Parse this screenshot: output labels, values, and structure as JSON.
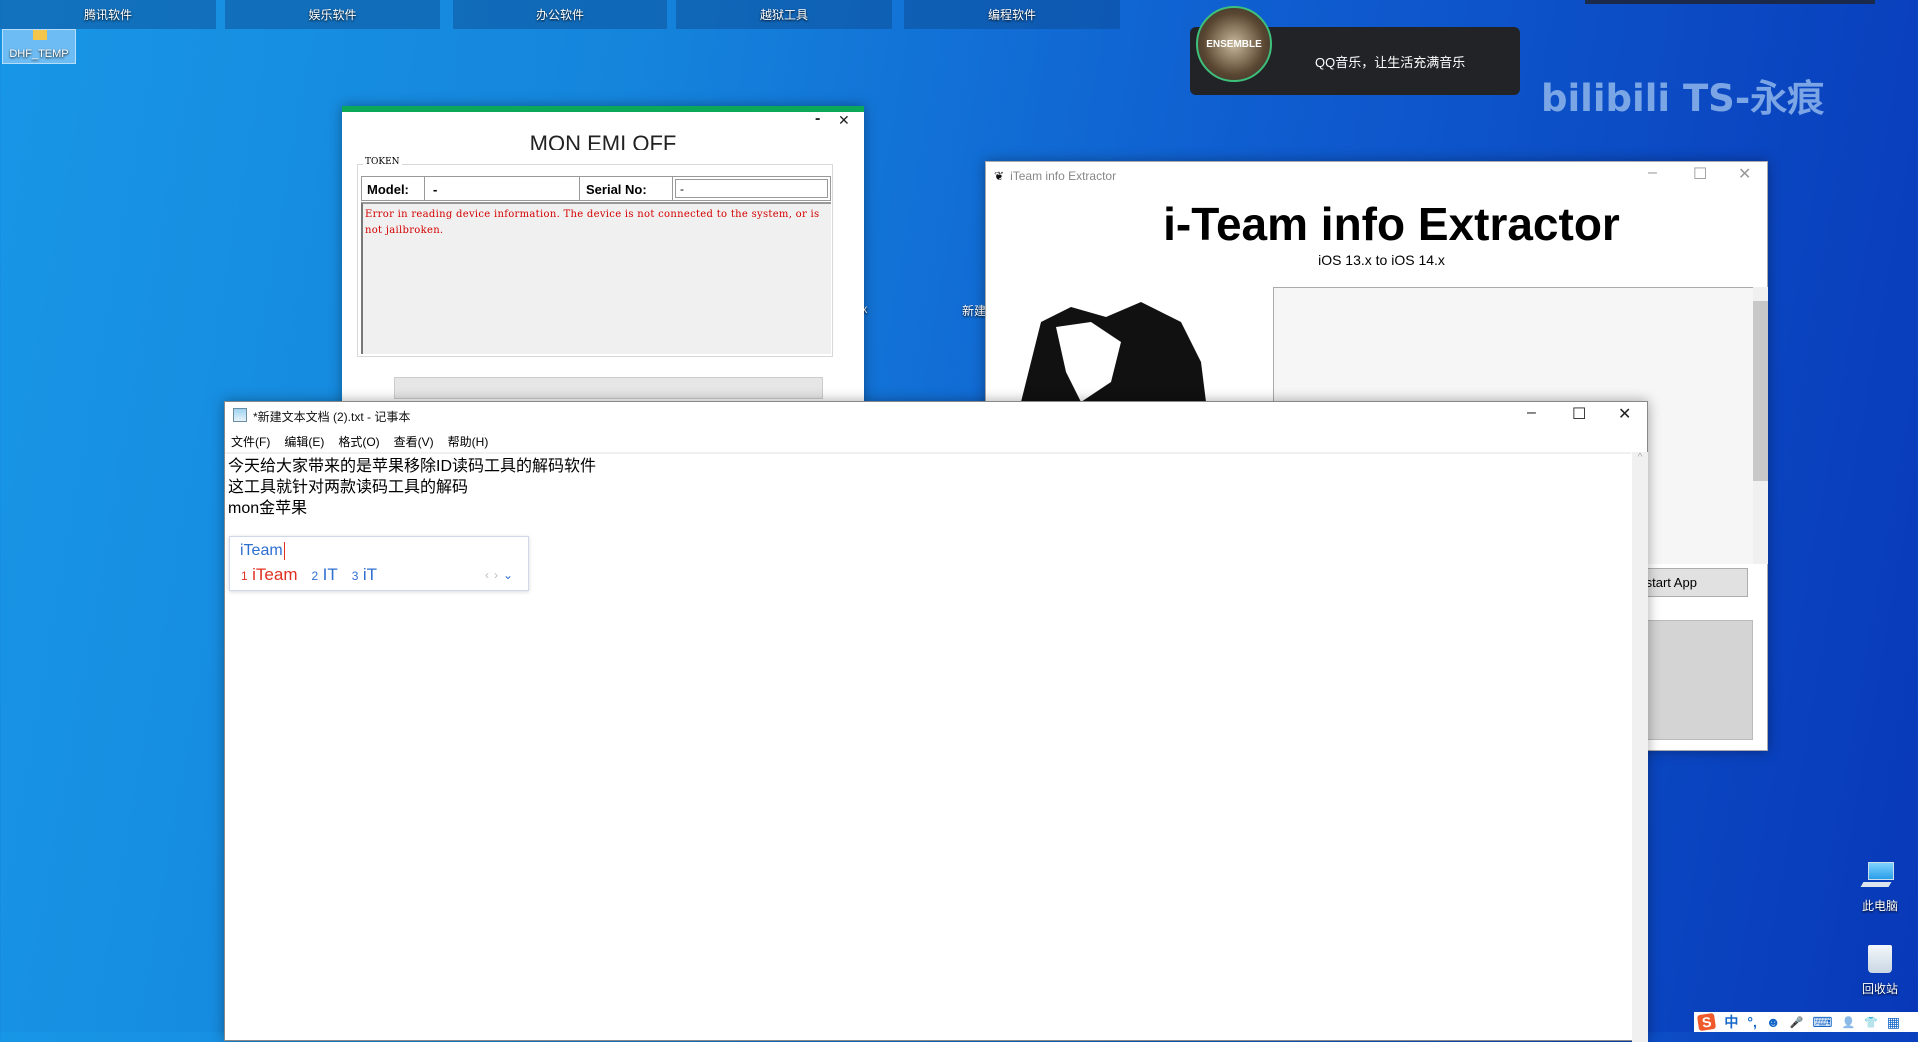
{
  "desktop": {
    "fences": [
      "腾讯软件",
      "娱乐软件",
      "办公软件",
      "越狱工具",
      "编程软件"
    ],
    "folder_icon": "DHF_TEMP",
    "watermark": "bilibili TS-永痕",
    "fragment_1": "tx",
    "fragment_2": "新建",
    "this_pc": "此电脑",
    "recycle_bin": "回收站"
  },
  "qq_toast": {
    "album_text": "ENSEMBLE",
    "message": "QQ音乐，让生活充满音乐"
  },
  "mon_window": {
    "title": "MON EMI OFF",
    "group": "TOKEN",
    "model_label": "Model:",
    "model_value": "-",
    "serial_label": "Serial No:",
    "serial_value": "-",
    "error": "Error in reading device information. The device is not connected to the system, or is not jailbroken.",
    "minimize": "-",
    "close": "✕",
    "error_color": "#d40000",
    "accent": "#0aa858"
  },
  "iteam_window": {
    "window_title": "iTeam info Extractor",
    "heading": "i-Team info Extractor",
    "subtitle": "iOS 13.x to iOS 14.x",
    "restart_button": "Restart App"
  },
  "notepad": {
    "title": "*新建文本文档 (2).txt - 记事本",
    "menu": [
      "文件(F)",
      "编辑(E)",
      "格式(O)",
      "查看(V)",
      "帮助(H)"
    ],
    "lines": [
      "今天给大家带来的是苹果移除ID读码工具的解码软件",
      "这工具就针对两款读码工具的解码",
      "mon金苹果"
    ]
  },
  "ime": {
    "input": "iTeam",
    "candidates": [
      {
        "n": "1",
        "t": "iTeam"
      },
      {
        "n": "2",
        "t": "IT"
      },
      {
        "n": "3",
        "t": "iT"
      }
    ],
    "toolbar": [
      "S",
      "中",
      "°,",
      "☻",
      "🎤",
      "⌨",
      "👤",
      "👕",
      "▦"
    ]
  }
}
